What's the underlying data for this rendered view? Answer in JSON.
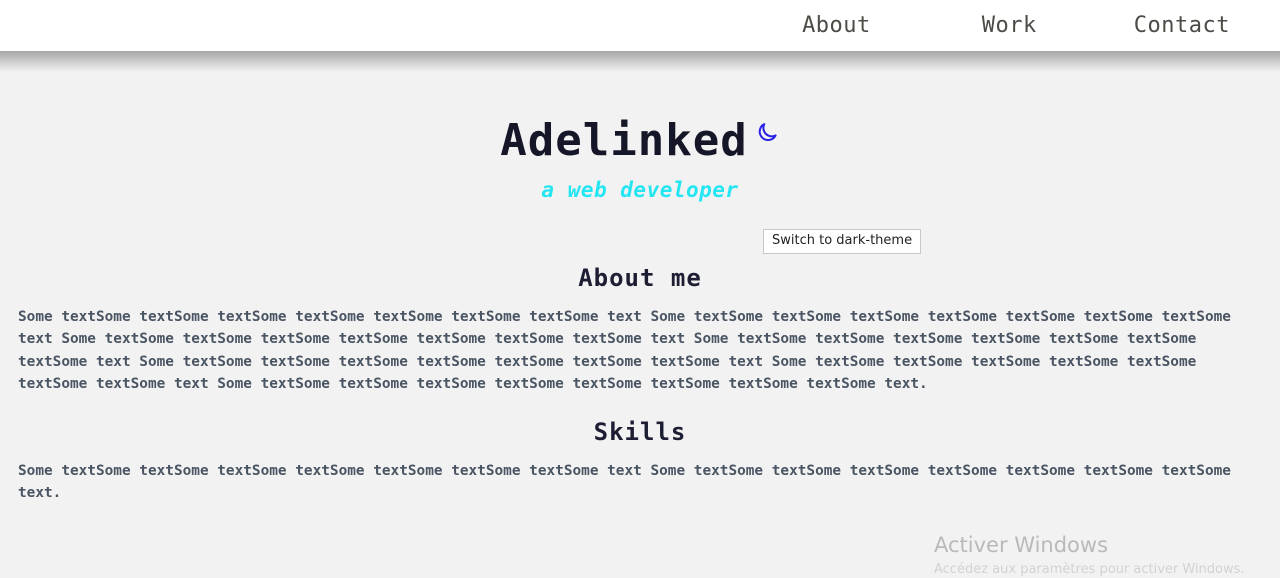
{
  "nav": {
    "items": [
      {
        "label": "About",
        "name": "nav-link-about"
      },
      {
        "label": "Work",
        "name": "nav-link-work"
      },
      {
        "label": "Contact",
        "name": "nav-link-contact"
      }
    ]
  },
  "hero": {
    "title": "Adelinked",
    "tagline": "a web developer",
    "theme_toggle": {
      "icon": "moon-icon",
      "icon_color": "#2a21e8",
      "tooltip": "Switch to dark-theme"
    }
  },
  "sections": [
    {
      "heading": "About me",
      "body": "Some textSome textSome textSome textSome textSome textSome textSome text Some textSome textSome textSome textSome textSome textSome textSome text Some textSome textSome textSome textSome textSome textSome textSome text Some textSome textSome textSome textSome textSome textSome textSome text Some textSome textSome textSome textSome textSome textSome textSome text Some textSome textSome textSome textSome textSome textSome textSome text Some textSome textSome textSome textSome textSome textSome textSome textSome text."
    },
    {
      "heading": "Skills",
      "body": "Some textSome textSome textSome textSome textSome textSome textSome text Some textSome textSome textSome textSome textSome textSome textSome text."
    }
  ],
  "watermark": {
    "title": "Activer Windows",
    "subtitle": "Accédez aux paramètres pour activer Windows."
  },
  "colors": {
    "page_background": "#f2f2f2",
    "header_background": "#ffffff",
    "nav_text": "#4c4c47",
    "title_text": "#161629",
    "tagline_accent": "#24e5f2",
    "body_text": "#4a5563",
    "heading_text": "#1d1d33",
    "moon_icon": "#2a21e8"
  }
}
